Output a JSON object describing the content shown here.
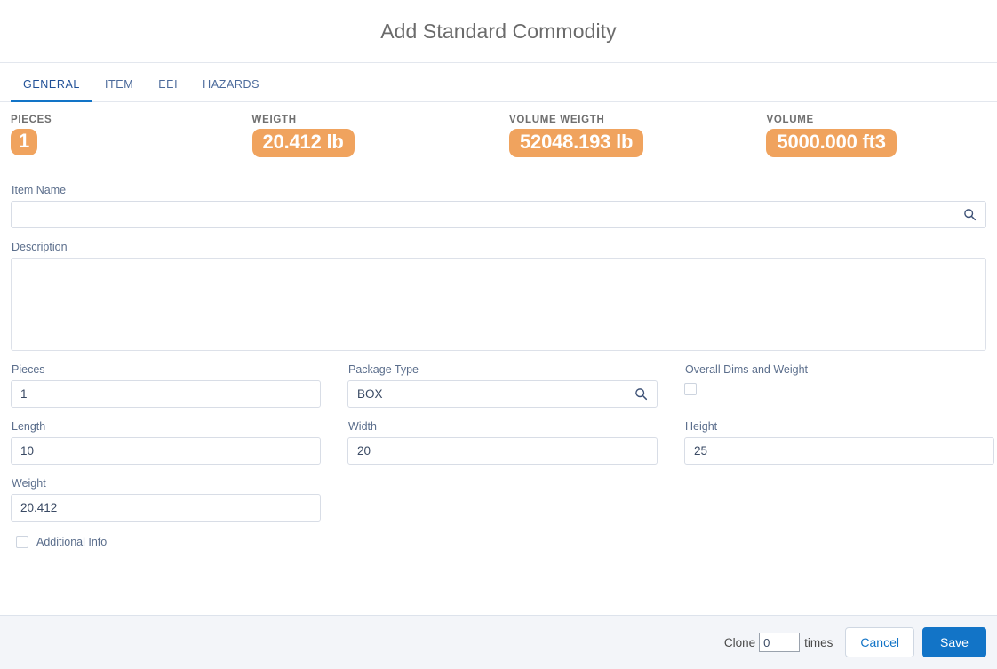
{
  "header": {
    "title": "Add Standard Commodity"
  },
  "tabs": [
    {
      "label": "GENERAL",
      "active": true
    },
    {
      "label": "ITEM",
      "active": false
    },
    {
      "label": "EEI",
      "active": false
    },
    {
      "label": "HAZARDS",
      "active": false
    }
  ],
  "summary": [
    {
      "label": "PIECES",
      "value": "1"
    },
    {
      "label": "WEIGTH",
      "value": "20.412 lb"
    },
    {
      "label": "VOLUME WEIGTH",
      "value": "52048.193 lb"
    },
    {
      "label": "VOLUME",
      "value": "5000.000 ft3"
    }
  ],
  "form": {
    "item_name": {
      "label": "Item Name",
      "value": "",
      "placeholder": "",
      "icon": "search-icon"
    },
    "description": {
      "label": "Description",
      "value": "",
      "placeholder": ""
    },
    "pieces": {
      "label": "Pieces",
      "value": "1"
    },
    "package_type": {
      "label": "Package Type",
      "value": "BOX",
      "icon": "search-icon"
    },
    "overall_dims": {
      "label": "Overall Dims and Weight",
      "checked": false
    },
    "length": {
      "label": "Length",
      "value": "10"
    },
    "width": {
      "label": "Width",
      "value": "20"
    },
    "height": {
      "label": "Height",
      "value": "25"
    },
    "weight": {
      "label": "Weight",
      "value": "20.412"
    },
    "additional_info": {
      "label": "Additional Info",
      "checked": false
    }
  },
  "footer": {
    "clone_label": "Clone",
    "clone_value": "0",
    "times_label": "times",
    "cancel_label": "Cancel",
    "save_label": "Save"
  },
  "colors": {
    "badge": "#f0a35e",
    "accent": "#1274c7",
    "label": "#5b6e8c",
    "footer_bg": "#f3f5f9"
  }
}
